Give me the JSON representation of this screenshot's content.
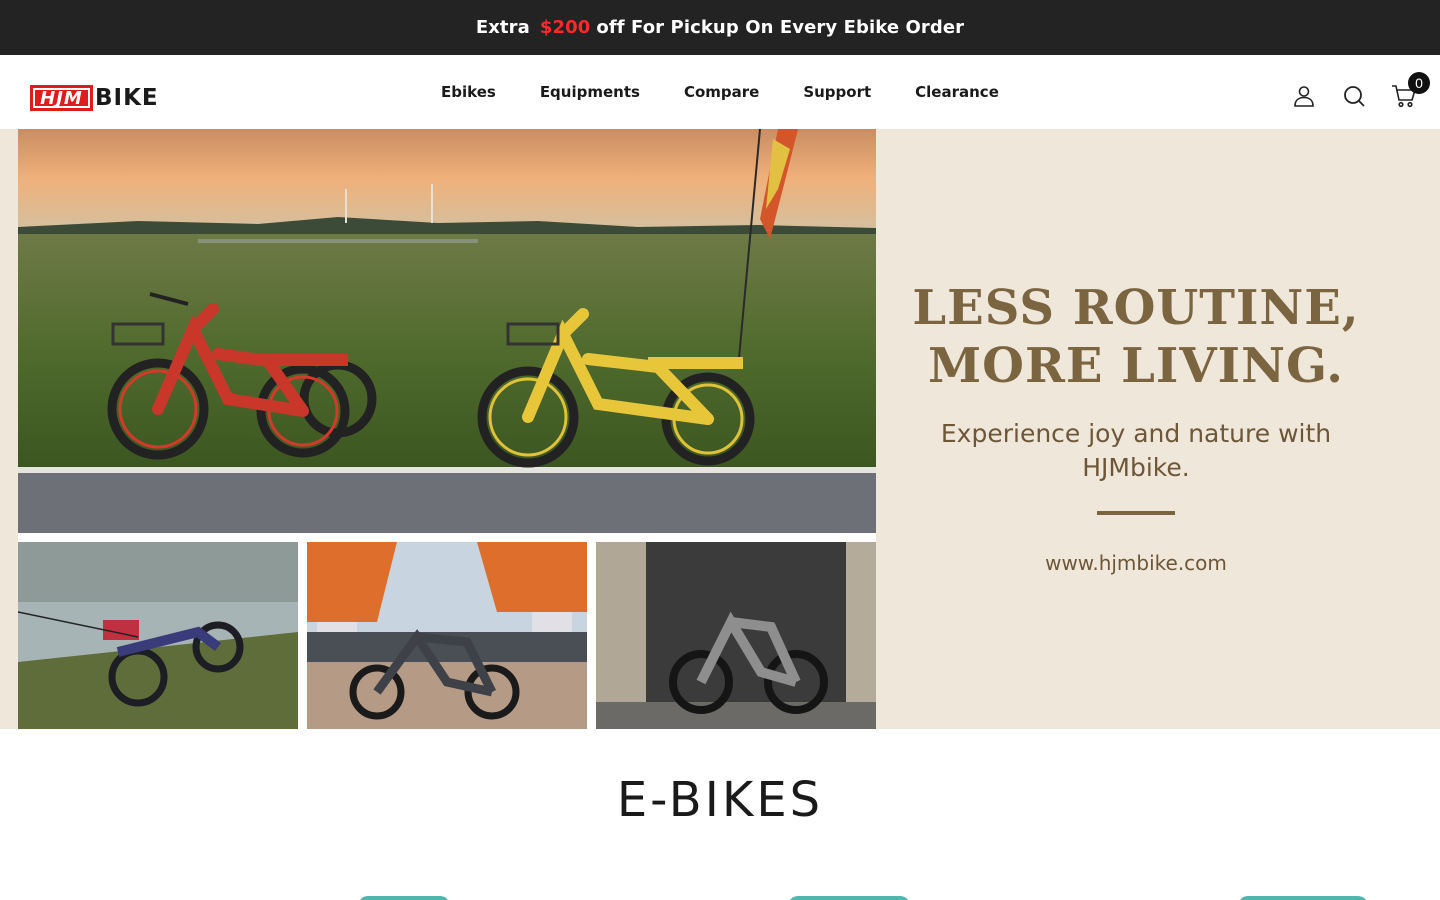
{
  "announcement": {
    "prefix": "Extra",
    "price": "$200",
    "suffix": "off For Pickup On Every Ebike Order"
  },
  "header": {
    "logo_mark": "HJM",
    "logo_text": "BIKE",
    "nav": [
      {
        "label": "Ebikes"
      },
      {
        "label": "Equipments"
      },
      {
        "label": "Compare"
      },
      {
        "label": "Support"
      },
      {
        "label": "Clearance"
      }
    ],
    "icons": [
      "account-icon",
      "search-icon",
      "cart-icon"
    ],
    "cart_count": "0"
  },
  "hero": {
    "title_line1": "LESS ROUTINE,",
    "title_line2": "MORE LIVING.",
    "subtitle": "Experience joy and nature with HJMbike.",
    "url": "www.hjmbike.com",
    "accent_color": "#7b6440",
    "background_color": "#efe7da"
  },
  "section": {
    "title": "E-BIKES"
  },
  "colors": {
    "announcement_bg": "#232323",
    "price_red": "#ff2a2a",
    "brand_red": "#e01b1b",
    "teal_tab": "#4fb5ad"
  }
}
